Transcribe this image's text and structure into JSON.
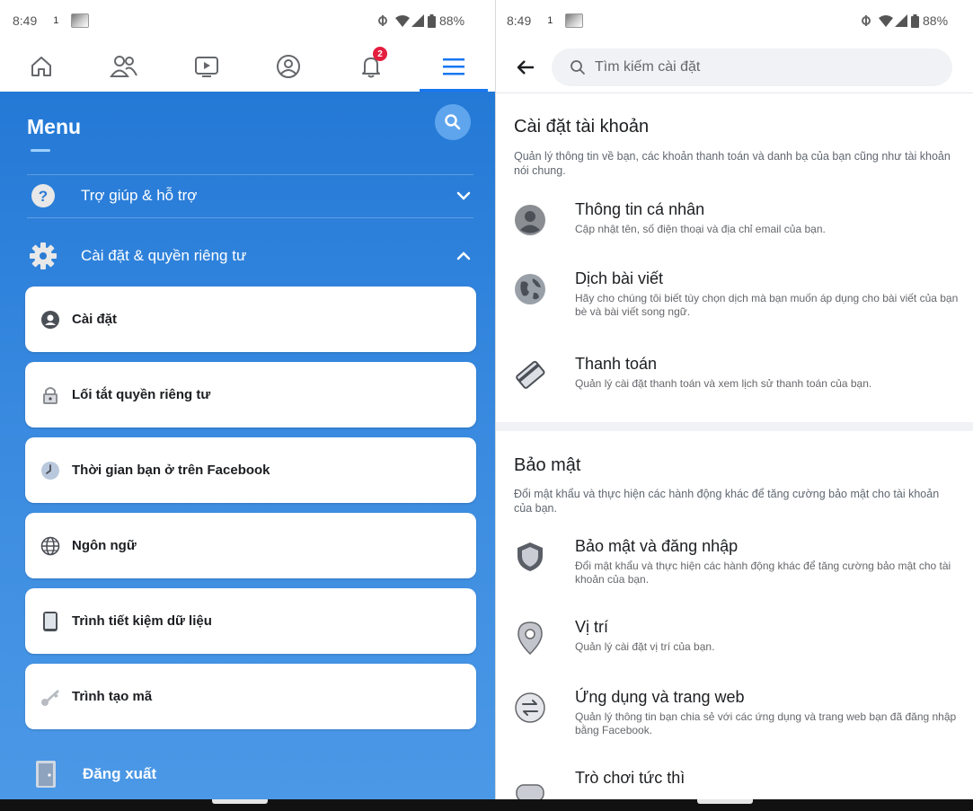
{
  "left": {
    "status": {
      "time": "8:49",
      "notif_mini": "1",
      "battery": "88%"
    },
    "topnav": [
      {
        "name": "home-icon"
      },
      {
        "name": "friends-icon"
      },
      {
        "name": "watch-icon"
      },
      {
        "name": "profile-icon"
      },
      {
        "name": "notifications-icon",
        "badge": "2"
      },
      {
        "name": "menu-icon",
        "active": true
      }
    ],
    "menu": {
      "title": "Menu",
      "sections": [
        {
          "label": "Trợ giúp & hỗ trợ",
          "icon": "help-icon",
          "expanded": false
        },
        {
          "label": "Cài đặt & quyền riêng tư",
          "icon": "settings-gear-icon",
          "expanded": true
        }
      ],
      "cards": [
        {
          "label": "Cài đặt",
          "icon": "account-circle-icon"
        },
        {
          "label": "Lối tắt quyền riêng tư",
          "icon": "lock-icon"
        },
        {
          "label": "Thời gian bạn ở trên Facebook",
          "icon": "clock-icon"
        },
        {
          "label": "Ngôn ngữ",
          "icon": "globe-icon"
        },
        {
          "label": "Trình tiết kiệm dữ liệu",
          "icon": "phone-icon"
        },
        {
          "label": "Trình tạo mã",
          "icon": "key-icon"
        }
      ],
      "logout": "Đăng xuất"
    }
  },
  "right": {
    "status": {
      "time": "8:49",
      "notif_mini": "1",
      "battery": "88%"
    },
    "search_placeholder": "Tìm kiếm cài đặt",
    "sections": [
      {
        "title": "Cài đặt tài khoản",
        "desc": "Quản lý thông tin về bạn, các khoản thanh toán và danh bạ của bạn cũng như tài khoản nói chung.",
        "items": [
          {
            "title": "Thông tin cá nhân",
            "desc": "Cập nhật tên, số điện thoại và địa chỉ email của bạn.",
            "icon": "person-icon"
          },
          {
            "title": "Dịch bài viết",
            "desc": "Hãy cho chúng tôi biết tùy chọn dịch mà bạn muốn áp dụng cho bài viết của bạn bè và bài viết song ngữ.",
            "icon": "globe-icon"
          },
          {
            "title": "Thanh toán",
            "desc": "Quản lý cài đặt thanh toán và xem lịch sử thanh toán của bạn.",
            "icon": "credit-card-icon"
          }
        ]
      },
      {
        "title": "Bảo mật",
        "desc": "Đổi mật khẩu và thực hiện các hành động khác để tăng cường bảo mật cho tài khoản của bạn.",
        "items": [
          {
            "title": "Bảo mật và đăng nhập",
            "desc": "Đổi mật khẩu và thực hiện các hành động khác để tăng cường bảo mật cho tài khoản của bạn.",
            "icon": "shield-icon"
          },
          {
            "title": "Vị trí",
            "desc": "Quản lý cài đặt vị trí của bạn.",
            "icon": "location-pin-icon"
          },
          {
            "title": "Ứng dụng và trang web",
            "desc": "Quản lý thông tin bạn chia sẻ với các ứng dụng và trang web bạn đã đăng nhập bằng Facebook.",
            "icon": "swap-arrows-icon"
          },
          {
            "title": "Trò chơi tức thì",
            "desc": "",
            "icon": "game-controller-icon"
          }
        ]
      }
    ]
  },
  "colors": {
    "accent": "#1877f2",
    "menu_bg": "#2479d6",
    "badge": "#e41e3f"
  }
}
